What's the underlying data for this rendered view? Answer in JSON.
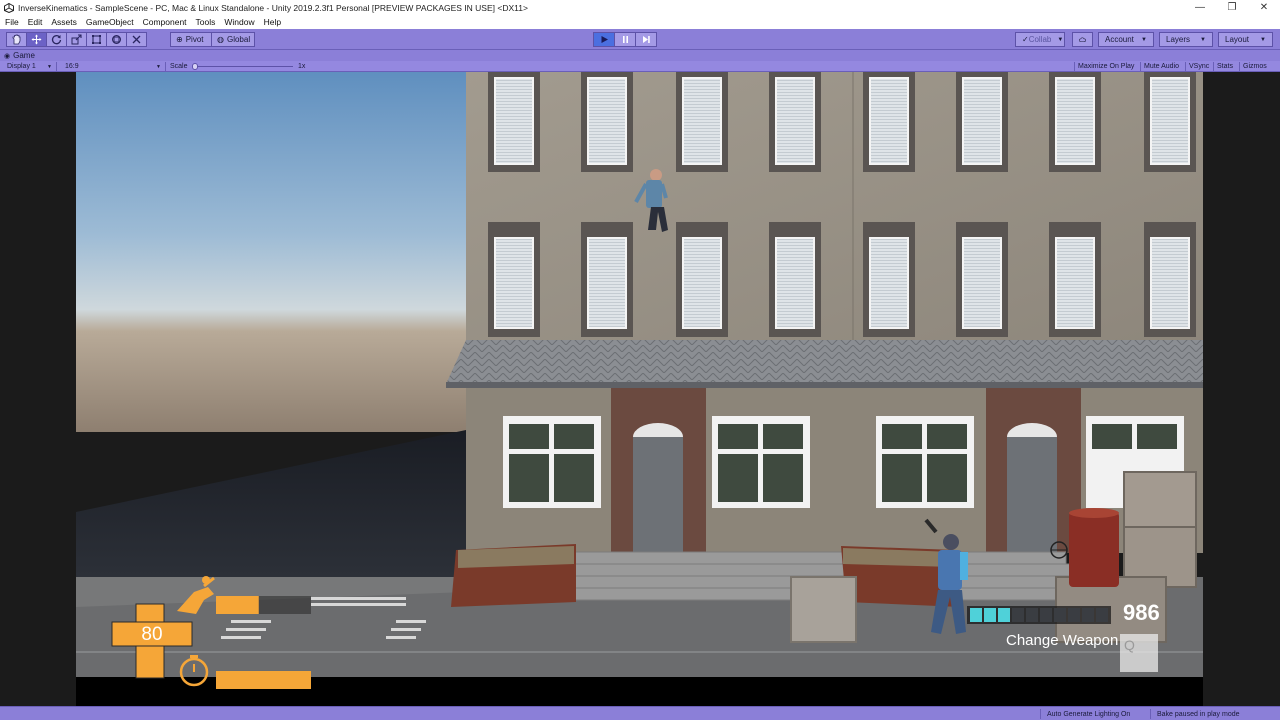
{
  "window": {
    "title": "InverseKinematics - SampleScene - PC, Mac & Linux Standalone - Unity 2019.2.3f1 Personal [PREVIEW PACKAGES IN USE] <DX11>",
    "minimize": "—",
    "restore": "❐",
    "close": "✕"
  },
  "menu": [
    "File",
    "Edit",
    "Assets",
    "GameObject",
    "Component",
    "Tools",
    "Window",
    "Help"
  ],
  "toolbar": {
    "pivot_label": "Pivot",
    "global_label": "Global",
    "collab_label": "Collab",
    "account_label": "Account",
    "layers_label": "Layers",
    "layout_label": "Layout"
  },
  "game_tab": {
    "label": "Game"
  },
  "game_controls": {
    "display": "Display 1",
    "aspect": "16:9",
    "scale_label": "Scale",
    "scale_value": "1x",
    "maximize_on_play": "Maximize On Play",
    "mute_audio": "Mute Audio",
    "vsync": "VSync",
    "stats": "Stats",
    "gizmos": "Gizmos"
  },
  "hud": {
    "health": "80",
    "ammo": "986",
    "ammo_cells_filled": 3,
    "ammo_cells_total": 10,
    "change_weapon": "Change Weapon",
    "change_weapon_key": "Q",
    "dash_fill": 0.45,
    "timer_fill": 1.0
  },
  "status": {
    "auto_generate": "Auto Generate Lighting On",
    "bake": "Bake paused in play mode"
  },
  "colors": {
    "toolbar": "#8b7fd8",
    "hud_orange": "#f5a638",
    "ammo_cyan": "#4fd1d9"
  }
}
